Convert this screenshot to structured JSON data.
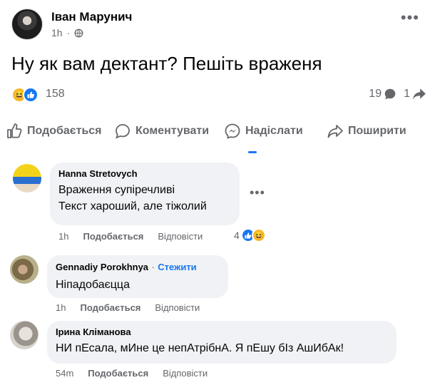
{
  "post": {
    "author": "Іван Марунич",
    "time": "1h",
    "text": "Ну як вам дектант? Пешіть враженя",
    "reaction_count": "158",
    "comments_count": "19",
    "shares_count": "1"
  },
  "actions": {
    "like": "Подобається",
    "comment": "Коментувати",
    "send": "Надіслати",
    "share": "Поширити"
  },
  "comments": [
    {
      "name": "Hanna Stretovych",
      "lines": [
        "Враження супіречливі",
        "Текст хароший, але тіжолий"
      ],
      "time": "1h",
      "like": "Подобається",
      "reply": "Відповісти",
      "reactions": "4"
    },
    {
      "name": "Gennadiy Porokhnya",
      "sep": "·",
      "follow": "Стежити",
      "lines": [
        "Ніпадобаєцца"
      ],
      "time": "1h",
      "like": "Подобається",
      "reply": "Відповісти"
    },
    {
      "name": "Ірина Кліманова",
      "lines": [
        "НИ пЕсала, мИне це непАтрібнА. Я пЕшу бІз АшИбАк!"
      ],
      "time": "54m",
      "like": "Подобається",
      "reply": "Відповісти"
    }
  ],
  "colors": {
    "accent": "#1877f2",
    "muted": "#65676b",
    "bubble": "#f0f2f5"
  }
}
